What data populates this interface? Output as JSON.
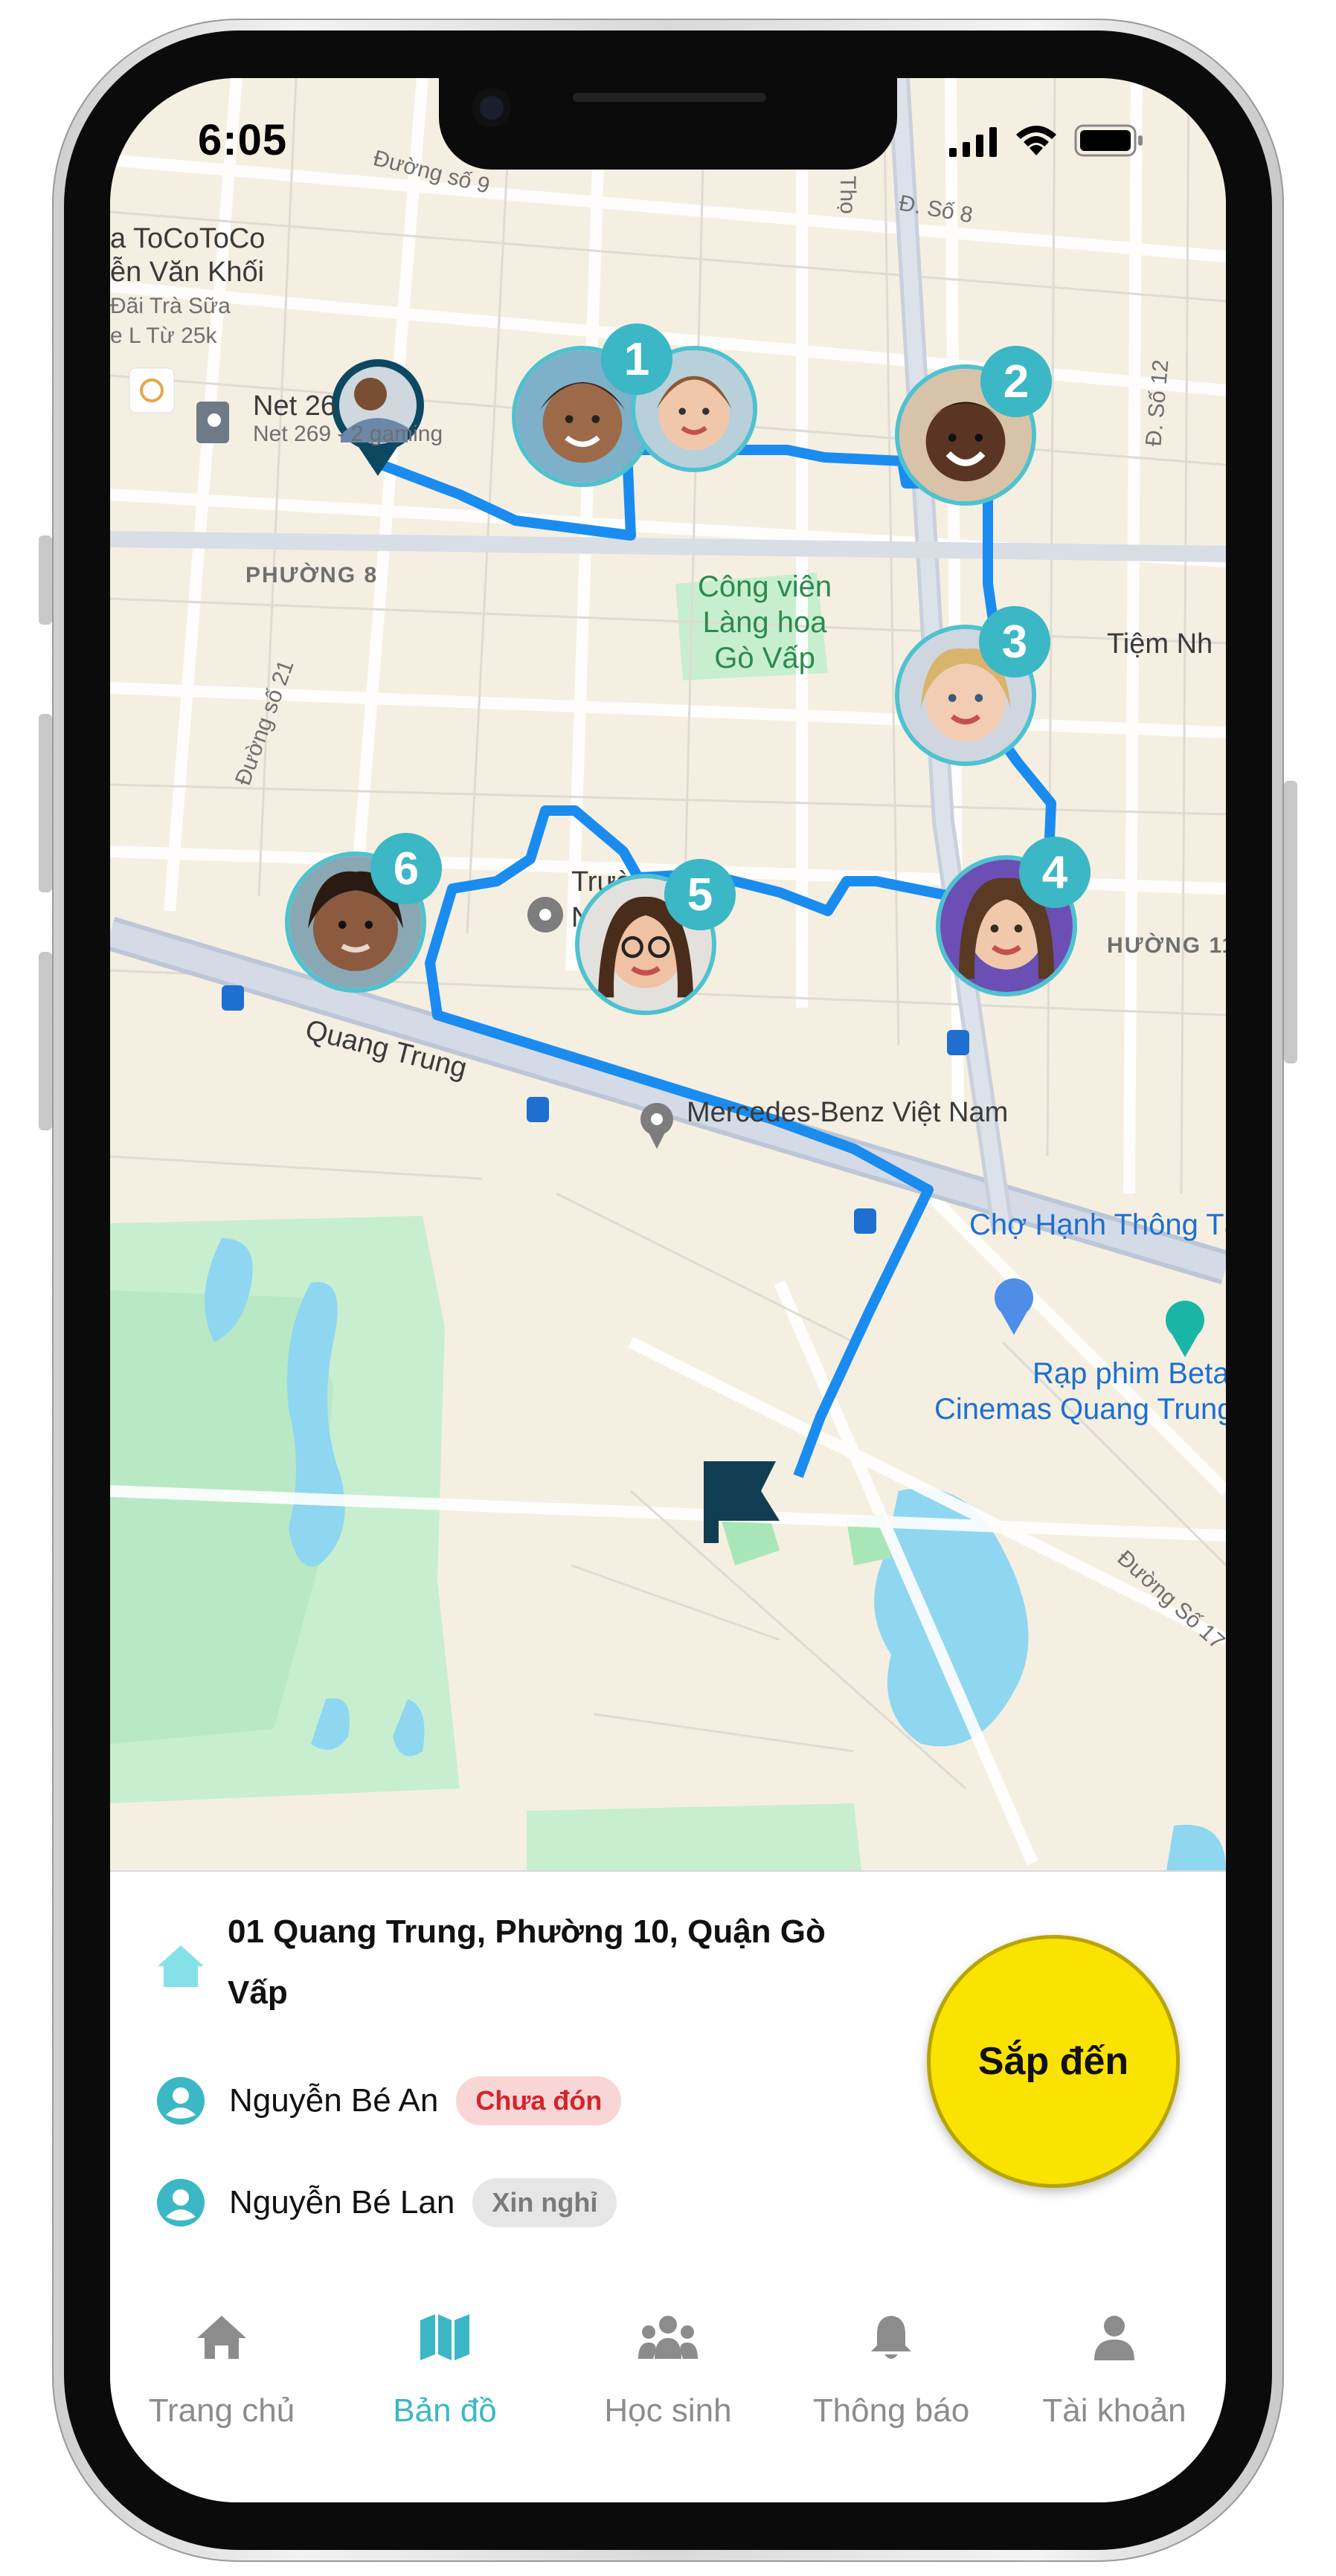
{
  "status_bar": {
    "time": "6:05"
  },
  "map": {
    "labels": {
      "duong_so_9": "Đường số 9",
      "d_so_8": "Đ. Số 8",
      "tho": "Thọ",
      "tocotoco_1": "a ToCoToCo",
      "tocotoco_2": "ễn Văn Khối",
      "tocotoco_3": "Đãi Trà Sữa",
      "tocotoco_4": "e L Từ 25k",
      "net_1": "Net 26",
      "net_2": "Net 269 - 2 gaming",
      "phuong_8": "PHƯỜNG 8",
      "park": "Công viên\nLàng hoa\nGò Vấp",
      "tiem": "Tiệm Nh",
      "duong_so_21": "Đường số 21",
      "d_so_12": "Đ. Số 12",
      "truong": "Trường T",
      "truong_2": "Ngu",
      "phuong_11": "HƯỜNG 11",
      "quang_trung": "Quang Trung",
      "mercedes": "Mercedes-Benz Việt Nam",
      "cho": "Chợ Hạnh Thông Tâ",
      "rap_1": "Rạp phim Beta",
      "rap_2": "Cinemas Quang Trung",
      "duong_so_17": "Đường Số 17"
    },
    "stops": [
      {
        "number": "1"
      },
      {
        "number": "2"
      },
      {
        "number": "3"
      },
      {
        "number": "4"
      },
      {
        "number": "5"
      },
      {
        "number": "6"
      }
    ]
  },
  "panel": {
    "address": "01 Quang Trung, Phường 10, Quận Gò Vấp",
    "students": [
      {
        "name": "Nguyễn Bé An",
        "status": "Chưa đón"
      },
      {
        "name": "Nguyễn Bé Lan",
        "status": "Xin nghỉ"
      }
    ],
    "cta_label": "Sắp đến"
  },
  "tabs": [
    {
      "label": "Trang chủ",
      "icon": "home-icon"
    },
    {
      "label": "Bản đồ",
      "icon": "map-icon",
      "active": true
    },
    {
      "label": "Học sinh",
      "icon": "students-icon"
    },
    {
      "label": "Thông báo",
      "icon": "bell-icon"
    },
    {
      "label": "Tài khoản",
      "icon": "account-icon"
    }
  ],
  "colors": {
    "accent": "#3bb7c5",
    "route": "#1a8cf0",
    "cta": "#fae300",
    "tag_red_text": "#d6242a",
    "map_bg": "#f5efe2",
    "park": "#c7efcf",
    "water": "#8fd6f0"
  }
}
